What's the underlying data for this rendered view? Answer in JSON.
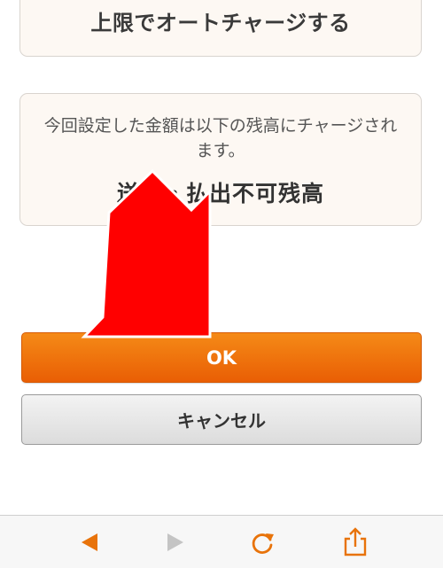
{
  "auto_charge": {
    "title": "上限でオートチャージする"
  },
  "notice": {
    "description": "今回設定した金額は以下の残高にチャージされます。",
    "target_balance": "送金・払出不可残高"
  },
  "buttons": {
    "ok_label": "OK",
    "cancel_label": "キャンセル"
  },
  "toolbar": {
    "icons": [
      "back-icon",
      "forward-icon",
      "reload-icon",
      "share-icon"
    ]
  },
  "colors": {
    "accent": "#ed6a08",
    "annotation_arrow": "#ff0000",
    "toolbar_icon": "#e8730a",
    "toolbar_icon_disabled": "#c4c4c4"
  }
}
